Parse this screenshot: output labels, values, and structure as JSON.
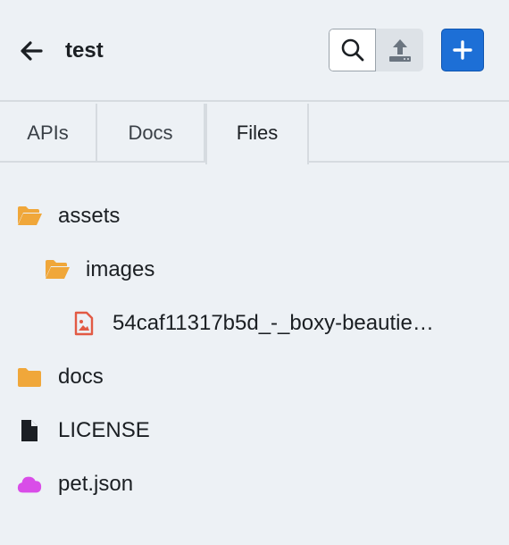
{
  "header": {
    "title": "test"
  },
  "colors": {
    "accent": "#1d6fd6",
    "folder": "#f0a73a",
    "image_file": "#e25a44",
    "cloud_file": "#d94de8"
  },
  "tabs": [
    {
      "label": "APIs"
    },
    {
      "label": "Docs"
    },
    {
      "label": "Files",
      "active": true
    }
  ],
  "tree": [
    {
      "label": "assets",
      "icon": "folder-open-icon",
      "depth": 0
    },
    {
      "label": "images",
      "icon": "folder-open-icon",
      "depth": 1
    },
    {
      "label": "54caf11317b5d_-_boxy-beautie…",
      "icon": "image-file-icon",
      "depth": 2
    },
    {
      "label": "docs",
      "icon": "folder-icon",
      "depth": 0
    },
    {
      "label": "LICENSE",
      "icon": "file-icon",
      "depth": 0
    },
    {
      "label": "pet.json",
      "icon": "cloud-icon",
      "depth": 0
    }
  ]
}
